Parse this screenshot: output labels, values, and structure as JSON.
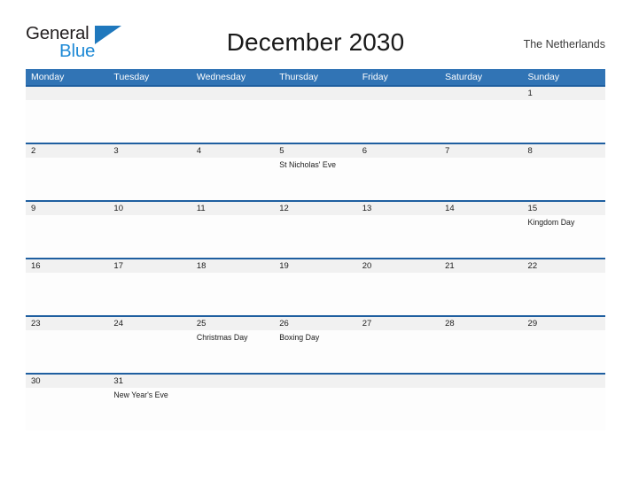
{
  "brand": {
    "name_part1": "General",
    "name_part2": "Blue",
    "flag_icon": "flag-triangle-icon",
    "color_dark": "#231f20",
    "color_blue": "#1f8ad6",
    "color_flag": "#1f78bd"
  },
  "header": {
    "title": "December 2030",
    "month": "December",
    "year": "2030",
    "locale": "The Netherlands"
  },
  "theme": {
    "header_blue": "#3174b5",
    "row_border_blue": "#1f5fa0",
    "date_band_gray": "#f1f1f1",
    "body_white": "#fdfdfd",
    "text_dark": "#1c1c1c"
  },
  "calendar": {
    "weekdays": [
      "Monday",
      "Tuesday",
      "Wednesday",
      "Thursday",
      "Friday",
      "Saturday",
      "Sunday"
    ],
    "weeks": [
      {
        "days": [
          {
            "date": "",
            "event": ""
          },
          {
            "date": "",
            "event": ""
          },
          {
            "date": "",
            "event": ""
          },
          {
            "date": "",
            "event": ""
          },
          {
            "date": "",
            "event": ""
          },
          {
            "date": "",
            "event": ""
          },
          {
            "date": "1",
            "event": ""
          }
        ]
      },
      {
        "days": [
          {
            "date": "2",
            "event": ""
          },
          {
            "date": "3",
            "event": ""
          },
          {
            "date": "4",
            "event": ""
          },
          {
            "date": "5",
            "event": "St Nicholas' Eve"
          },
          {
            "date": "6",
            "event": ""
          },
          {
            "date": "7",
            "event": ""
          },
          {
            "date": "8",
            "event": ""
          }
        ]
      },
      {
        "days": [
          {
            "date": "9",
            "event": ""
          },
          {
            "date": "10",
            "event": ""
          },
          {
            "date": "11",
            "event": ""
          },
          {
            "date": "12",
            "event": ""
          },
          {
            "date": "13",
            "event": ""
          },
          {
            "date": "14",
            "event": ""
          },
          {
            "date": "15",
            "event": "Kingdom Day"
          }
        ]
      },
      {
        "days": [
          {
            "date": "16",
            "event": ""
          },
          {
            "date": "17",
            "event": ""
          },
          {
            "date": "18",
            "event": ""
          },
          {
            "date": "19",
            "event": ""
          },
          {
            "date": "20",
            "event": ""
          },
          {
            "date": "21",
            "event": ""
          },
          {
            "date": "22",
            "event": ""
          }
        ]
      },
      {
        "days": [
          {
            "date": "23",
            "event": ""
          },
          {
            "date": "24",
            "event": ""
          },
          {
            "date": "25",
            "event": "Christmas Day"
          },
          {
            "date": "26",
            "event": "Boxing Day"
          },
          {
            "date": "27",
            "event": ""
          },
          {
            "date": "28",
            "event": ""
          },
          {
            "date": "29",
            "event": ""
          }
        ]
      },
      {
        "days": [
          {
            "date": "30",
            "event": ""
          },
          {
            "date": "31",
            "event": "New Year's Eve"
          },
          {
            "date": "",
            "event": ""
          },
          {
            "date": "",
            "event": ""
          },
          {
            "date": "",
            "event": ""
          },
          {
            "date": "",
            "event": ""
          },
          {
            "date": "",
            "event": ""
          }
        ]
      }
    ]
  }
}
